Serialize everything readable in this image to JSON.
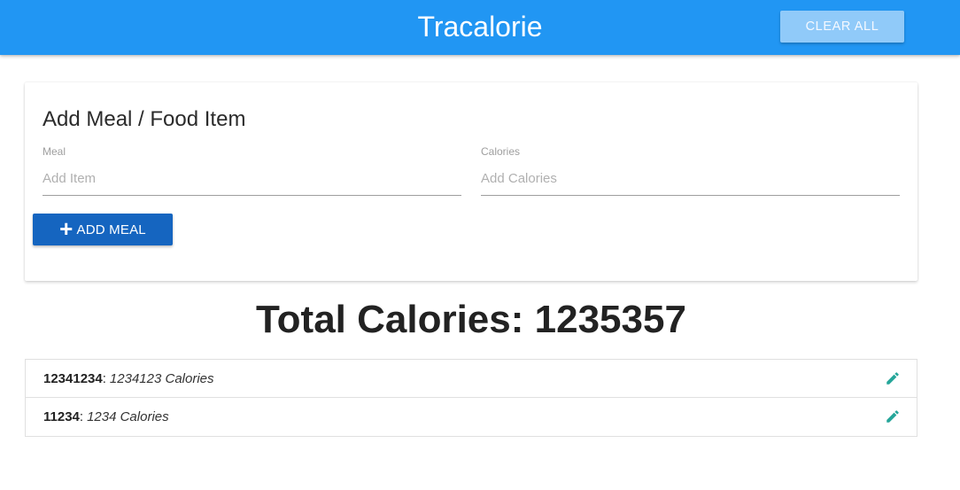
{
  "header": {
    "brand": "Tracalorie",
    "clear_all_label": "CLEAR ALL"
  },
  "form": {
    "title": "Add Meal / Food Item",
    "meal": {
      "label": "Meal",
      "placeholder": "Add Item",
      "value": ""
    },
    "calories": {
      "label": "Calories",
      "placeholder": "Add Calories",
      "value": ""
    },
    "add_button_label": "ADD MEAL",
    "add_button_icon": "plus-icon"
  },
  "total": {
    "label": "Total Calories:",
    "value": "1235357"
  },
  "items": [
    {
      "name": "12341234",
      "calories": "1234123 Calories",
      "icon": "pencil-icon"
    },
    {
      "name": "11234",
      "calories": "1234 Calories",
      "icon": "pencil-icon"
    }
  ],
  "colors": {
    "header_bg": "#2196f3",
    "clear_button_bg": "#90caf9",
    "add_button_bg": "#1565c0",
    "edit_icon": "#26a69a"
  }
}
